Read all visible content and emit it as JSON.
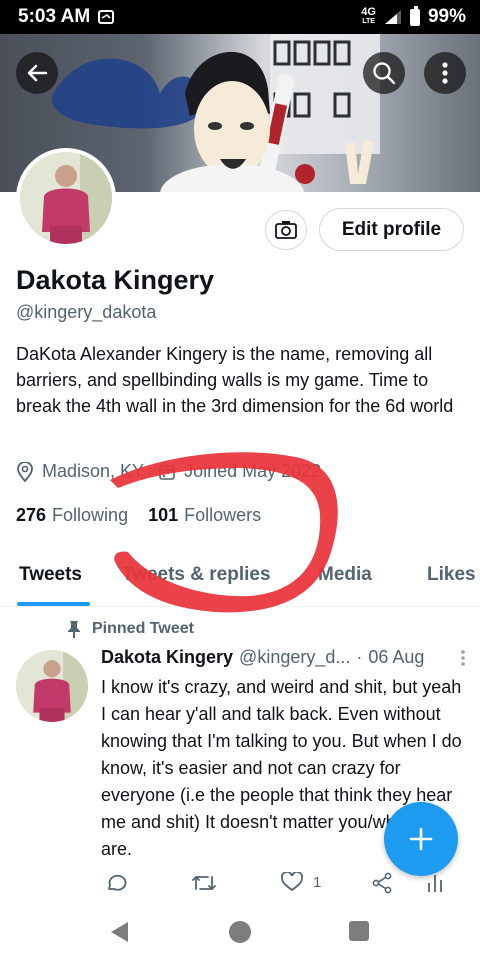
{
  "status": {
    "time": "5:03 AM",
    "network": "4G",
    "network_sub": "LTE",
    "battery": "99%"
  },
  "profile": {
    "name": "Dakota Kingery",
    "handle": "@kingery_dakota",
    "bio": "DaKota Alexander Kingery is the name, removing all barriers, and spellbinding walls is my game. Time to break the 4th wall in the 3rd dimension for the 6d world",
    "location": "Madison, KY",
    "joined": "Joined May 2022",
    "following_count": "276",
    "following_label": "Following",
    "followers_count": "101",
    "followers_label": "Followers",
    "edit_label": "Edit profile"
  },
  "tabs": [
    {
      "label": "Tweets",
      "active": true
    },
    {
      "label": "Tweets & replies",
      "active": false
    },
    {
      "label": "Media",
      "active": false
    },
    {
      "label": "Likes",
      "active": false
    }
  ],
  "tweet": {
    "pinned_label": "Pinned Tweet",
    "author": "Dakota Kingery",
    "handle": "@kingery_d...",
    "date": "06 Aug",
    "text": "I know it's crazy, and weird and shit, but yeah I can hear y'all and talk back. Even without knowing that I'm talking to you. But when I do know, it's easier and not can crazy for everyone (i.e the people that think they hear me and shit) It doesn't matter you/what you are.",
    "likes": "1"
  },
  "colors": {
    "accent": "#1d9bf0",
    "scribble": "#e8343a"
  },
  "icons": [
    "back-arrow-icon",
    "search-icon",
    "more-vertical-icon",
    "camera-icon",
    "location-pin-icon",
    "calendar-icon",
    "pin-icon",
    "reply-icon",
    "retweet-icon",
    "like-icon",
    "share-icon",
    "analytics-icon",
    "compose-plus-icon"
  ]
}
